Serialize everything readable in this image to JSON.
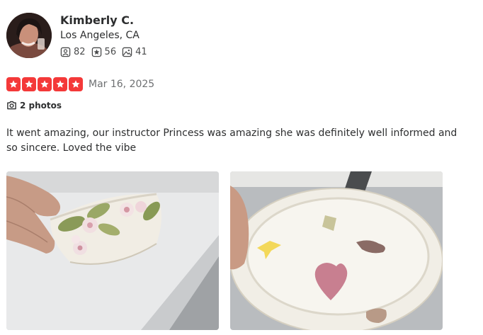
{
  "user": {
    "name": "Kimberly C.",
    "location": "Los Angeles, CA",
    "stats": {
      "friends": "82",
      "reviews": "56",
      "photos": "41"
    },
    "icons": {
      "friends": "friends-icon",
      "reviews": "review-star-icon",
      "photos": "photo-icon"
    }
  },
  "review": {
    "rating": 5,
    "rating_max": 5,
    "date": "Mar 16, 2025",
    "photo_count_label": "2 photos",
    "text": "It went amazing, our instructor Princess was amazing she was definitely well informed and so sincere. Loved the vibe"
  },
  "colors": {
    "star_red": "#f43939",
    "text": "#2d2e2f",
    "muted": "#6e7072"
  }
}
